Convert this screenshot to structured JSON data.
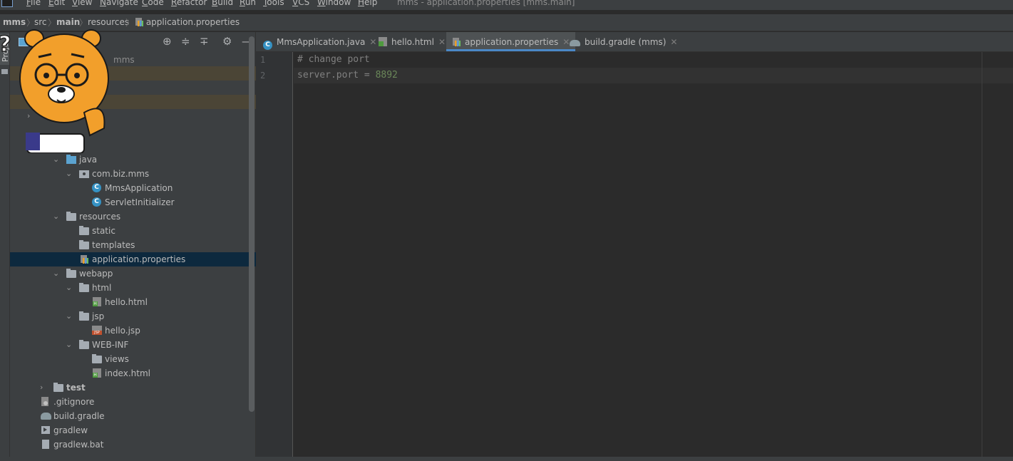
{
  "menubar": {
    "items": [
      "File",
      "Edit",
      "View",
      "Navigate",
      "Code",
      "Refactor",
      "Build",
      "Run",
      "Tools",
      "VCS",
      "Window",
      "Help"
    ],
    "window_title": "mms - application.properties [mms.main]"
  },
  "breadcrumb": {
    "items": [
      "mms",
      "src",
      "main",
      "resources",
      "application.properties"
    ]
  },
  "project_panel": {
    "side_tab": "Proje",
    "root_suffix": "mms",
    "tree": [
      {
        "label": "java",
        "icon": "folder-blue-icon"
      },
      {
        "label": "com.biz.mms",
        "icon": "package-icon"
      },
      {
        "label": "MmsApplication",
        "icon": "spring-class-icon"
      },
      {
        "label": "ServletInitializer",
        "icon": "class-icon"
      },
      {
        "label": "resources",
        "icon": "resources-folder-icon"
      },
      {
        "label": "static",
        "icon": "folder-icon"
      },
      {
        "label": "templates",
        "icon": "folder-icon"
      },
      {
        "label": "application.properties",
        "icon": "properties-file-icon",
        "selected": true
      },
      {
        "label": "webapp",
        "icon": "folder-icon"
      },
      {
        "label": "html",
        "icon": "folder-icon"
      },
      {
        "label": "hello.html",
        "icon": "html-file-icon"
      },
      {
        "label": "jsp",
        "icon": "folder-icon"
      },
      {
        "label": "hello.jsp",
        "icon": "jsp-file-icon"
      },
      {
        "label": "WEB-INF",
        "icon": "folder-icon"
      },
      {
        "label": "views",
        "icon": "folder-icon"
      },
      {
        "label": "index.html",
        "icon": "html-file-icon"
      },
      {
        "label": "test",
        "icon": "test-folder-icon"
      },
      {
        "label": ".gitignore",
        "icon": "gitignore-icon"
      },
      {
        "label": "build.gradle",
        "icon": "gradle-icon"
      },
      {
        "label": "gradlew",
        "icon": "executable-icon"
      },
      {
        "label": "gradlew.bat",
        "icon": "file-icon"
      }
    ]
  },
  "tabs": [
    {
      "label": "MmsApplication.java",
      "icon": "spring-class-icon"
    },
    {
      "label": "hello.html",
      "icon": "html-file-icon"
    },
    {
      "label": "application.properties",
      "icon": "properties-file-icon",
      "active": true
    },
    {
      "label": "build.gradle (mms)",
      "icon": "gradle-icon"
    }
  ],
  "editor": {
    "line_numbers": [
      "1",
      "2"
    ],
    "line1_comment": "# change port",
    "line2_key": "server.port",
    "line2_op": " = ",
    "line2_value": "8892"
  },
  "colors": {
    "accent": "#4a88c7",
    "selection": "#0d293e",
    "comment": "#808080",
    "value": "#6a8759"
  }
}
